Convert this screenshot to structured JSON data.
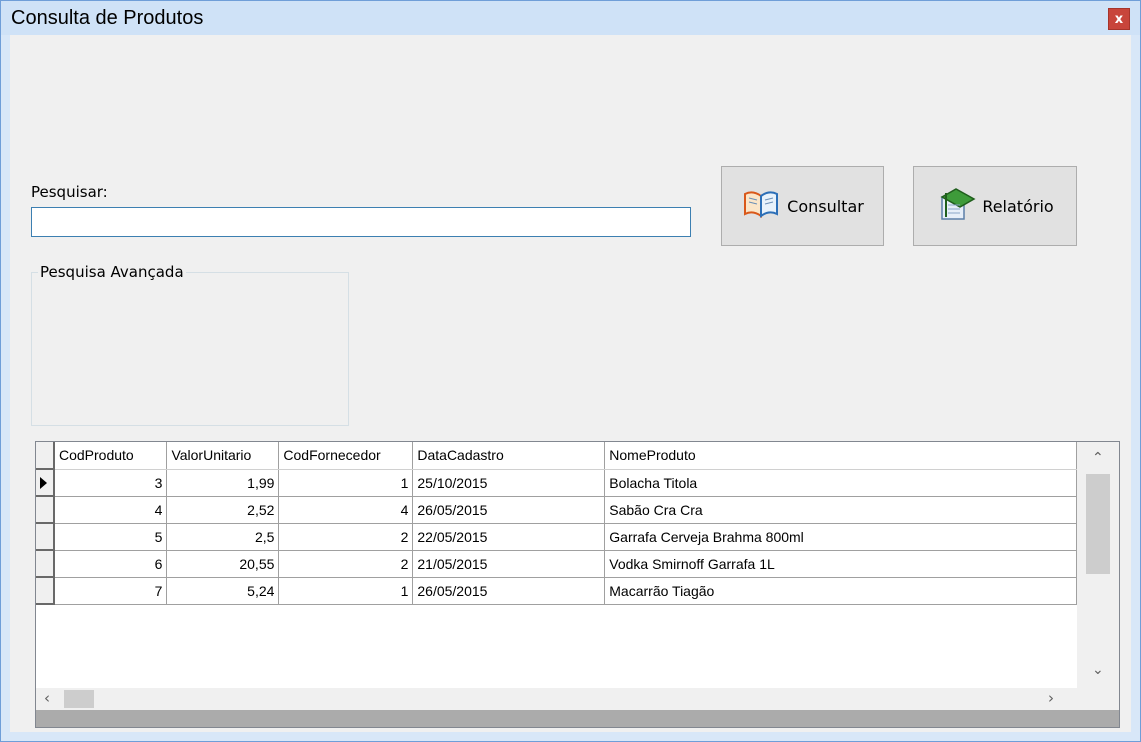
{
  "window": {
    "title": "Consulta de Produtos",
    "close_label": "x"
  },
  "search": {
    "label": "Pesquisar:",
    "value": "",
    "placeholder": ""
  },
  "buttons": {
    "consultar": {
      "label": "Consultar",
      "icon": "open-book-icon"
    },
    "relatorio": {
      "label": "Relatório",
      "icon": "green-notebook-icon"
    }
  },
  "advanced": {
    "legend": "Pesquisa Avançada"
  },
  "grid": {
    "columns": [
      "CodProduto",
      "ValorUnitario",
      "CodFornecedor",
      "DataCadastro",
      "NomeProduto"
    ],
    "rows": [
      [
        "3",
        "1,99",
        "1",
        "25/10/2015",
        "Bolacha Titola"
      ],
      [
        "4",
        "2,52",
        "4",
        "26/05/2015",
        "Sabão Cra Cra"
      ],
      [
        "5",
        "2,5",
        "2",
        "22/05/2015",
        "Garrafa Cerveja Brahma 800ml"
      ],
      [
        "6",
        "20,55",
        "2",
        "21/05/2015",
        "Vodka Smirnoff Garrafa 1L"
      ],
      [
        "7",
        "5,24",
        "1",
        "26/05/2015",
        "Macarrão Tiagão"
      ]
    ],
    "selected_row": 0
  }
}
